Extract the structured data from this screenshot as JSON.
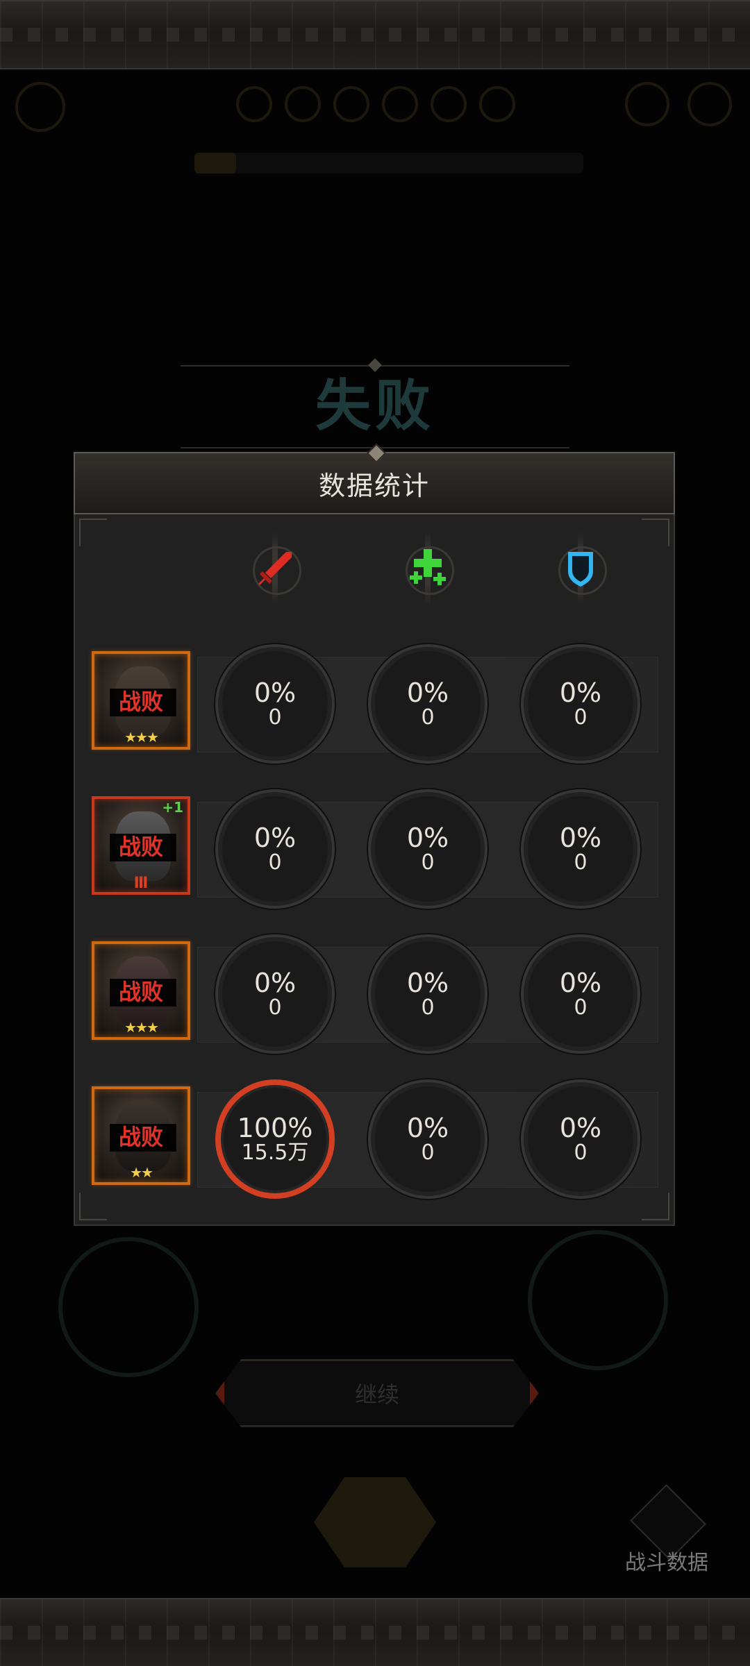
{
  "result_title": "失败",
  "panel": {
    "title": "数据统计",
    "columns": [
      {
        "icon": "sword-icon",
        "color": "#e02b22"
      },
      {
        "icon": "heal-cross-icon",
        "color": "#3fd43a"
      },
      {
        "icon": "shield-icon",
        "color": "#33b6f0"
      }
    ],
    "rows": [
      {
        "status": "战败",
        "stars": "★★★",
        "extra": "",
        "cells": [
          {
            "pct": "0%",
            "val": "0"
          },
          {
            "pct": "0%",
            "val": "0"
          },
          {
            "pct": "0%",
            "val": "0"
          }
        ]
      },
      {
        "status": "战败",
        "stars": "",
        "extra": "+1",
        "rank": "Ⅲ",
        "cells": [
          {
            "pct": "0%",
            "val": "0"
          },
          {
            "pct": "0%",
            "val": "0"
          },
          {
            "pct": "0%",
            "val": "0"
          }
        ]
      },
      {
        "status": "战败",
        "stars": "★★★",
        "extra": "",
        "cells": [
          {
            "pct": "0%",
            "val": "0"
          },
          {
            "pct": "0%",
            "val": "0"
          },
          {
            "pct": "0%",
            "val": "0"
          }
        ]
      },
      {
        "status": "战败",
        "stars": "★★",
        "extra": "",
        "cells": [
          {
            "pct": "100%",
            "val": "15.5万"
          },
          {
            "pct": "0%",
            "val": "0"
          },
          {
            "pct": "0%",
            "val": "0"
          }
        ]
      }
    ]
  },
  "continue_label": "继续",
  "battle_stats_label": "战斗数据"
}
